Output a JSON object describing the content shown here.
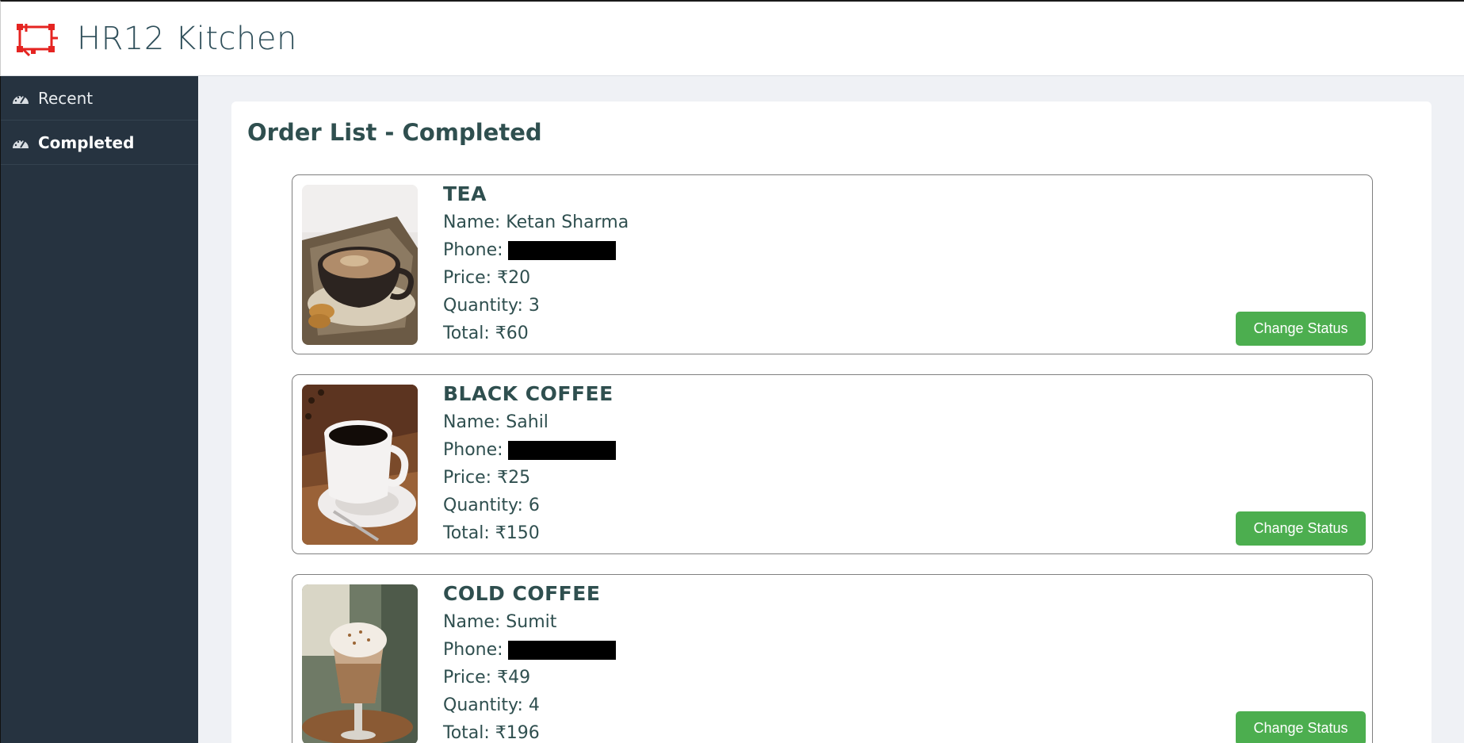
{
  "header": {
    "title": "HR12 Kitchen"
  },
  "sidebar": {
    "items": [
      {
        "label": "Recent",
        "icon": "dashboard-icon",
        "active": false
      },
      {
        "label": "Completed",
        "icon": "dashboard-icon",
        "active": true
      }
    ]
  },
  "main": {
    "title": "Order List - Completed",
    "orders": [
      {
        "item": "TEA",
        "name": "Name: Ketan Sharma",
        "phone_label": "Phone:",
        "price": "Price: ₹20",
        "quantity": "Quantity: 3",
        "total": "Total: ₹60",
        "button": "Change Status"
      },
      {
        "item": "BLACK COFFEE",
        "name": "Name: Sahil",
        "phone_label": "Phone:",
        "price": "Price: ₹25",
        "quantity": "Quantity: 6",
        "total": "Total: ₹150",
        "button": "Change Status"
      },
      {
        "item": "COLD COFFEE",
        "name": "Name: Sumit",
        "phone_label": "Phone:",
        "price": "Price: ₹49",
        "quantity": "Quantity: 4",
        "total": "Total: ₹196",
        "button": "Change Status"
      }
    ]
  },
  "colors": {
    "accent_button": "#4cae4f",
    "sidebar_bg": "#263340",
    "logo": "#e52421"
  }
}
